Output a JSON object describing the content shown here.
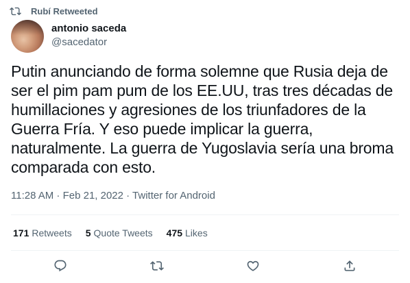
{
  "retweet": {
    "label": "Rubí Retweeted",
    "icon": "retweet-icon"
  },
  "author": {
    "name": "antonio saceda",
    "handle": "@sacedator",
    "avatar_icon": "avatar-photo"
  },
  "tweet": {
    "text": "Putin anunciando de forma solemne que Rusia deja de\nser el pim pam pum de los EE.UU, tras tres décadas de\nhumillaciones y agresiones de los triunfadores de la\nGuerra Fría. Y eso puede implicar la guerra,\nnaturalmente. La guerra de Yugoslavia sería una broma\ncomparada con esto.",
    "meta": "11:28 AM · Feb 21, 2022 · Twitter for Android"
  },
  "stats": {
    "retweets_count": "171",
    "retweets_label": "Retweets",
    "quotes_count": "5",
    "quotes_label": "Quote Tweets",
    "likes_count": "475",
    "likes_label": "Likes"
  },
  "actions": {
    "reply_icon": "reply-icon",
    "retweet_icon": "retweet-icon",
    "like_icon": "heart-icon",
    "share_icon": "share-icon"
  },
  "colors": {
    "text": "#0f1419",
    "secondary": "#536471",
    "divider": "#eff3f4"
  }
}
